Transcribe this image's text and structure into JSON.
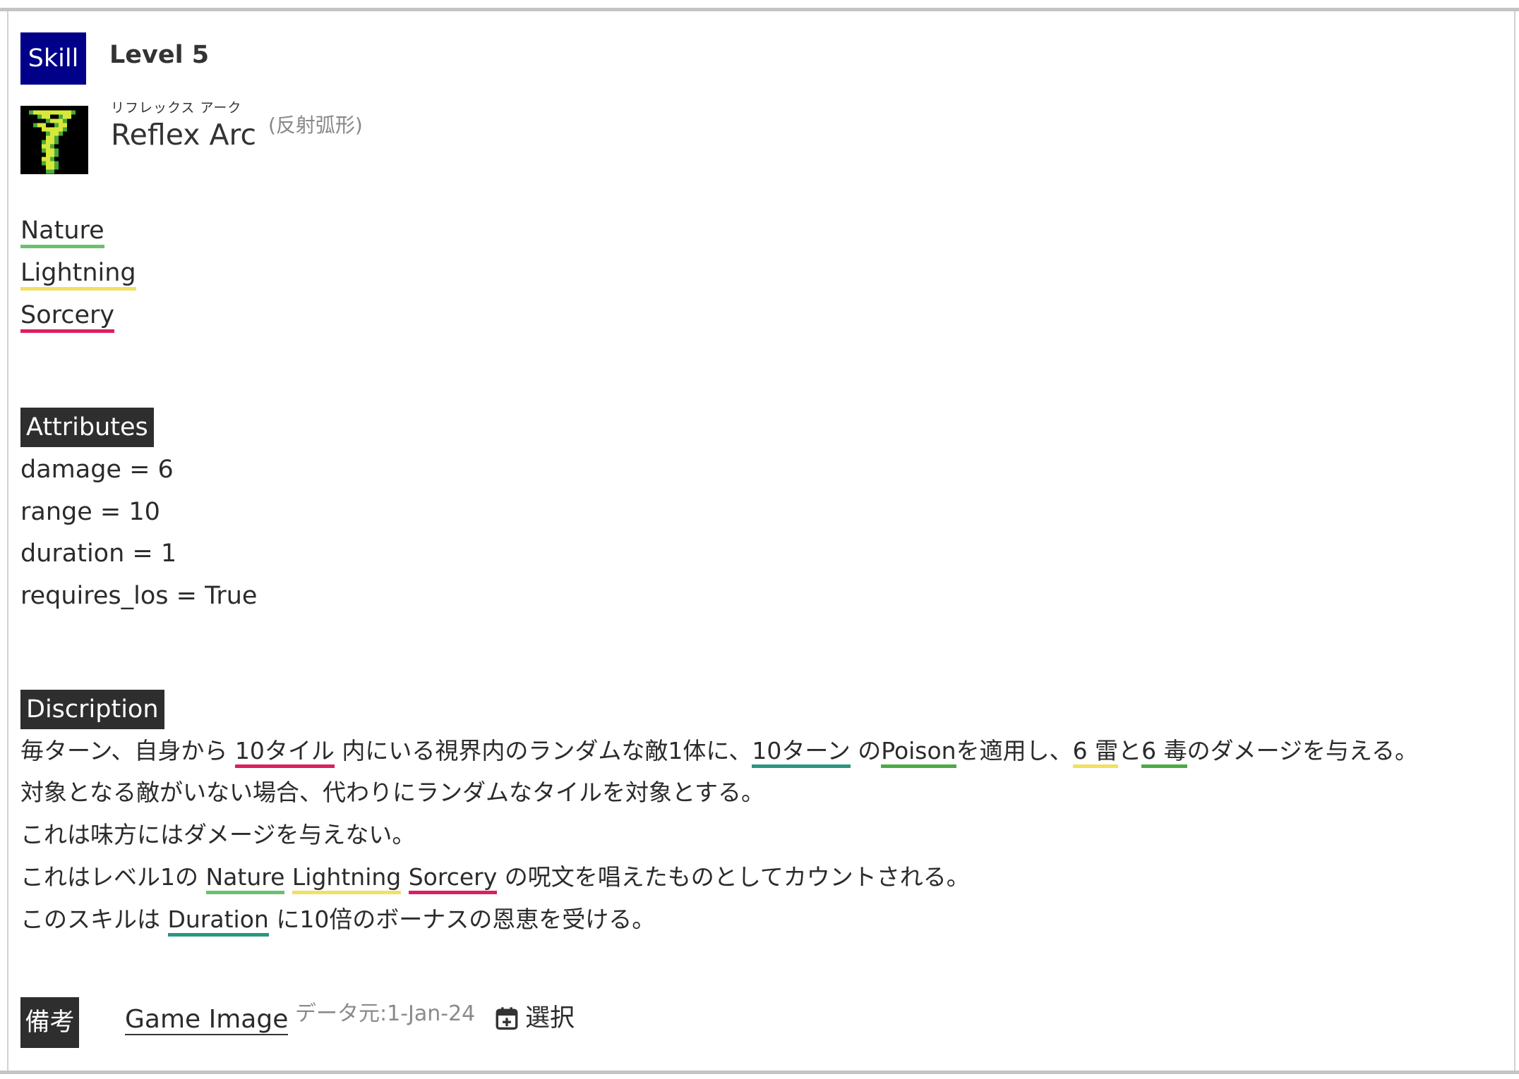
{
  "header": {
    "badge": "Skill",
    "level": "Level 5",
    "ruby": "リフレックス アーク",
    "name": "Reflex Arc",
    "name_jp": "(反射弧形)"
  },
  "tags": [
    "Nature",
    "Lightning",
    "Sorcery"
  ],
  "attributes_heading": "Attributes",
  "attributes": [
    "damage = 6",
    "range = 10",
    "duration = 1",
    "requires_los = True"
  ],
  "description_heading": "Discription",
  "description": {
    "l1": {
      "a": "毎ターン、自身から ",
      "b": "10タイル",
      "c": " 内にいる視界内のランダムな敵1体に、",
      "d": "10ターン",
      "e": " の",
      "f": "Poison",
      "g": "を適用し、",
      "h": "6 雷",
      "i": "と",
      "j": "6 毒",
      "k": "のダメージを与える。"
    },
    "l2": "対象となる敵がいない場合、代わりにランダムなタイルを対象とする。",
    "l3": "これは味方にはダメージを与えない。",
    "l4": {
      "a": "これはレベル1の ",
      "b": "Nature",
      "c": " ",
      "d": "Lightning",
      "e": " ",
      "f": "Sorcery",
      "g": " の呪文を唱えたものとしてカウントされる。"
    },
    "l5": {
      "a": "このスキルは ",
      "b": "Duration",
      "c": " に10倍のボーナスの恩恵を受ける。"
    }
  },
  "footer": {
    "note_badge": "備考",
    "game_image_link": "Game Image",
    "source": "データ元:1-Jan-24",
    "select_label": "選択"
  },
  "colors": {
    "skill_badge": "#000088",
    "nature": "#6cc070",
    "lightning": "#f2e060",
    "sorcery": "#dc1f60",
    "duration": "#2a9683",
    "poison": "#4aab45"
  },
  "icons": {
    "spell": "lightning-serpent-pixel-icon",
    "select": "calendar-plus-icon"
  }
}
